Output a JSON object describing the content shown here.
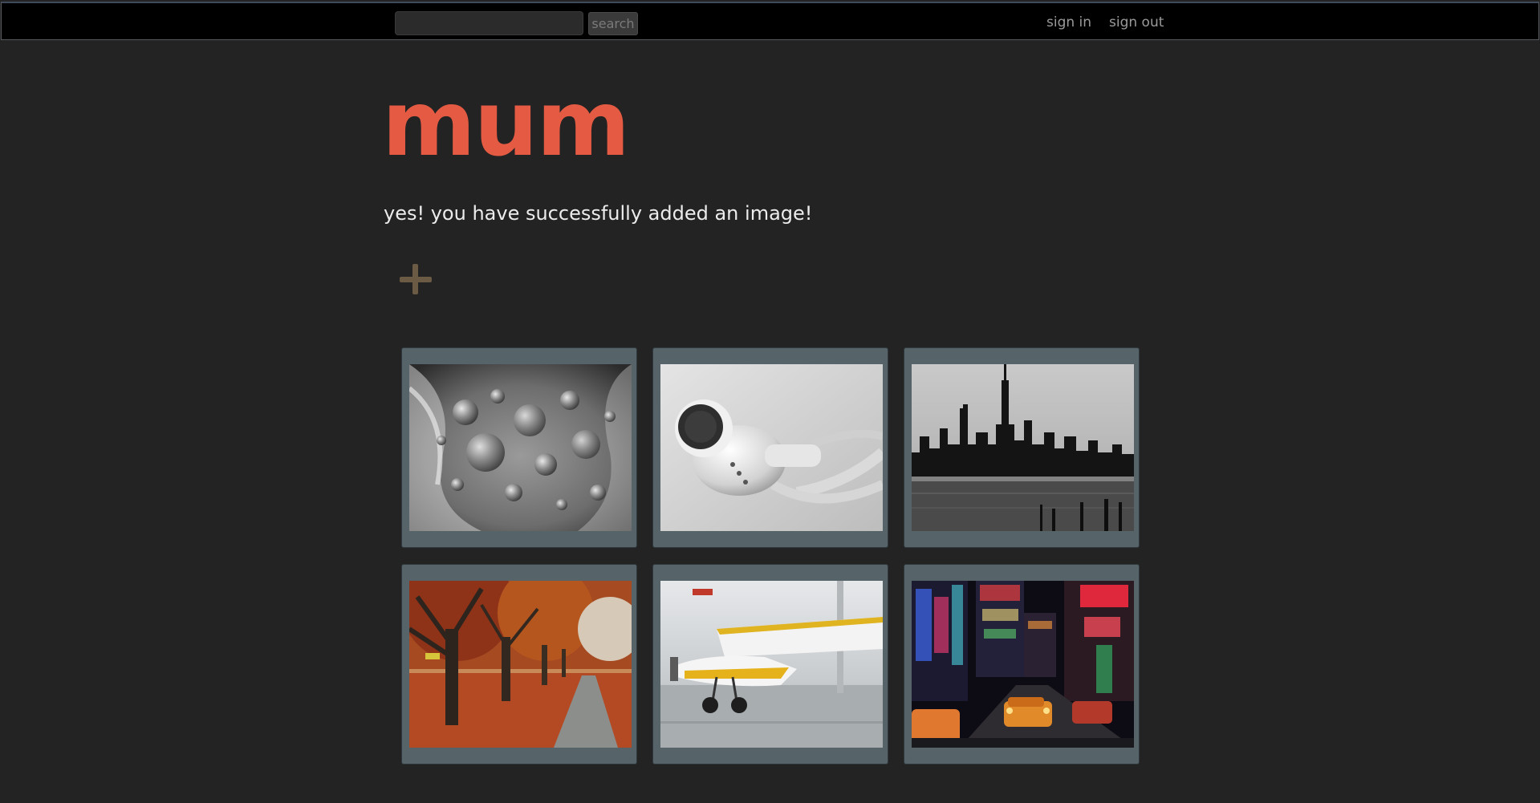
{
  "header": {
    "search_placeholder": "",
    "search_value": "",
    "search_label": "search",
    "nav": [
      "sign in",
      "sign out"
    ]
  },
  "logo": "mum",
  "flash_message": "yes! you have successfully added an image!",
  "add_button": {
    "icon": "plus-icon",
    "color": "#6b5a44"
  },
  "gallery": {
    "images": [
      {
        "name": "water-drops-photo",
        "subject": "water drops"
      },
      {
        "name": "earbuds-photo",
        "subject": "earbuds"
      },
      {
        "name": "city-skyline-photo",
        "subject": "city skyline"
      },
      {
        "name": "autumn-trees-photo",
        "subject": "autumn trees"
      },
      {
        "name": "airplane-photo",
        "subject": "airplane"
      },
      {
        "name": "night-street-photo",
        "subject": "night street"
      }
    ]
  },
  "colors": {
    "background": "#232323",
    "topbar": "#000000",
    "logo": "#e55a43",
    "tile": "#56646a"
  }
}
